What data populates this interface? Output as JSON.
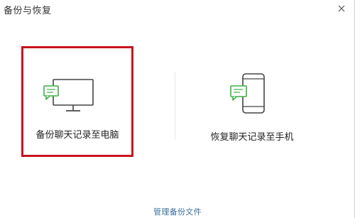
{
  "window": {
    "title": "备份与恢复"
  },
  "options": {
    "backup_to_pc": {
      "label": "备份聊天记录至电脑",
      "icon": "monitor-chat-icon",
      "selected": true
    },
    "restore_to_phone": {
      "label": "恢复聊天记录至手机",
      "icon": "phone-chat-icon",
      "selected": false
    }
  },
  "footer": {
    "manage_link": "管理备份文件"
  },
  "colors": {
    "accent_green": "#3cb043",
    "selection_red": "#c8141c",
    "link_blue": "#3c6e9c",
    "icon_stroke": "#444444"
  },
  "icons": {
    "close": "close-icon"
  }
}
